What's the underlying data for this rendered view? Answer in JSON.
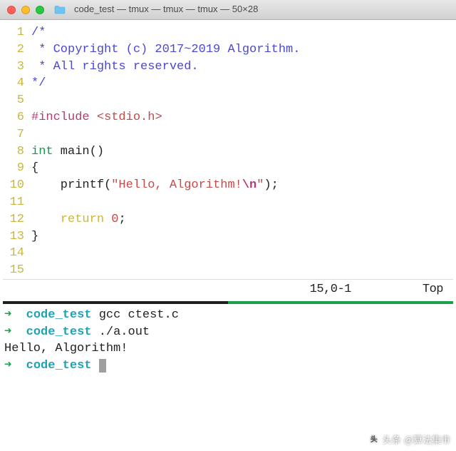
{
  "window": {
    "title": "code_test — tmux — tmux — tmux — 50×28"
  },
  "editor": {
    "lines": [
      {
        "n": "1",
        "segs": [
          {
            "cls": "c-comment",
            "t": "/*"
          }
        ]
      },
      {
        "n": "2",
        "segs": [
          {
            "cls": "c-comment",
            "t": " * Copyright (c) 2017~2019 Algorithm."
          }
        ]
      },
      {
        "n": "3",
        "segs": [
          {
            "cls": "c-comment",
            "t": " * All rights reserved."
          }
        ]
      },
      {
        "n": "4",
        "segs": [
          {
            "cls": "c-comment",
            "t": "*/"
          }
        ]
      },
      {
        "n": "5",
        "segs": []
      },
      {
        "n": "6",
        "segs": [
          {
            "cls": "c-pp",
            "t": "#include "
          },
          {
            "cls": "c-inc",
            "t": "<stdio.h>"
          }
        ]
      },
      {
        "n": "7",
        "segs": []
      },
      {
        "n": "8",
        "segs": [
          {
            "cls": "c-type",
            "t": "int"
          },
          {
            "cls": "c-ident",
            "t": " main()"
          }
        ]
      },
      {
        "n": "9",
        "segs": [
          {
            "cls": "c-ident",
            "t": "{"
          }
        ]
      },
      {
        "n": "10",
        "segs": [
          {
            "cls": "c-ident",
            "t": "    printf("
          },
          {
            "cls": "c-str",
            "t": "\"Hello, Algorithm!"
          },
          {
            "cls": "c-esc",
            "t": "\\n"
          },
          {
            "cls": "c-str",
            "t": "\""
          },
          {
            "cls": "c-ident",
            "t": ");"
          }
        ]
      },
      {
        "n": "11",
        "segs": []
      },
      {
        "n": "12",
        "segs": [
          {
            "cls": "c-ident",
            "t": "    "
          },
          {
            "cls": "c-kw",
            "t": "return"
          },
          {
            "cls": "c-ident",
            "t": " "
          },
          {
            "cls": "c-num",
            "t": "0"
          },
          {
            "cls": "c-ident",
            "t": ";"
          }
        ]
      },
      {
        "n": "13",
        "segs": [
          {
            "cls": "c-ident",
            "t": "}"
          }
        ]
      },
      {
        "n": "14",
        "segs": []
      },
      {
        "n": "15",
        "segs": []
      }
    ]
  },
  "statusbar": {
    "position": "15,0-1",
    "scroll": "Top"
  },
  "terminal": {
    "prompt_arrow": "➜",
    "cwd": "code_test",
    "cmd1": "gcc ctest.c",
    "cmd2": "./a.out",
    "output": "Hello, Algorithm!"
  },
  "watermark": {
    "prefix": "头条",
    "handle": "@算法集市"
  }
}
